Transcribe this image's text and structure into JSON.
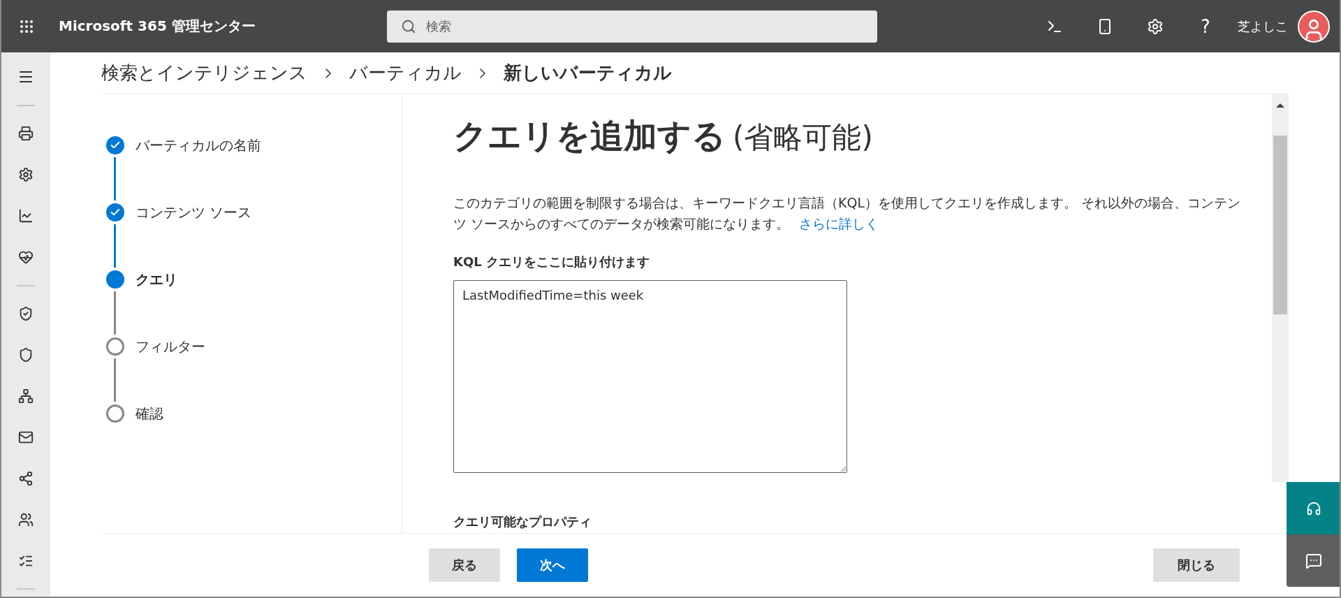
{
  "topbar": {
    "title": "Microsoft 365 管理センター",
    "search": {
      "placeholder": "検索"
    },
    "help": "?",
    "user": "芝よしこ"
  },
  "breadcrumb": [
    {
      "label": "検索とインテリジェンス",
      "current": false
    },
    {
      "label": "バーティカル",
      "current": false
    },
    {
      "label": "新しいバーティカル",
      "current": true
    }
  ],
  "steps": [
    {
      "label": "バーティカルの名前",
      "completed": true,
      "selected": false
    },
    {
      "label": "コンテンツ ソース",
      "completed": true,
      "selected": false
    },
    {
      "label": "クエリ",
      "completed": false,
      "selected": true
    },
    {
      "label": "フィルター",
      "completed": false,
      "selected": false
    },
    {
      "label": "確認",
      "completed": false,
      "selected": false
    }
  ],
  "content": {
    "title": "クエリを追加する",
    "title_note": "(省略可能)",
    "description": "このカテゴリの範囲を制限する場合は、キーワードクエリ言語（KQL）を使用してクエリを作成します。 それ以外の場合、コンテンツ ソースからのすべてのデータが検索可能になります。",
    "link": "さらに詳しく",
    "query_label": "KQL クエリをここに貼り付けます",
    "query_value": "LastModifiedTime=this week",
    "properties_heading": "クエリ可能なプロパティ"
  },
  "footer": {
    "back": "戻る",
    "next": "次へ",
    "close": "閉じる"
  }
}
